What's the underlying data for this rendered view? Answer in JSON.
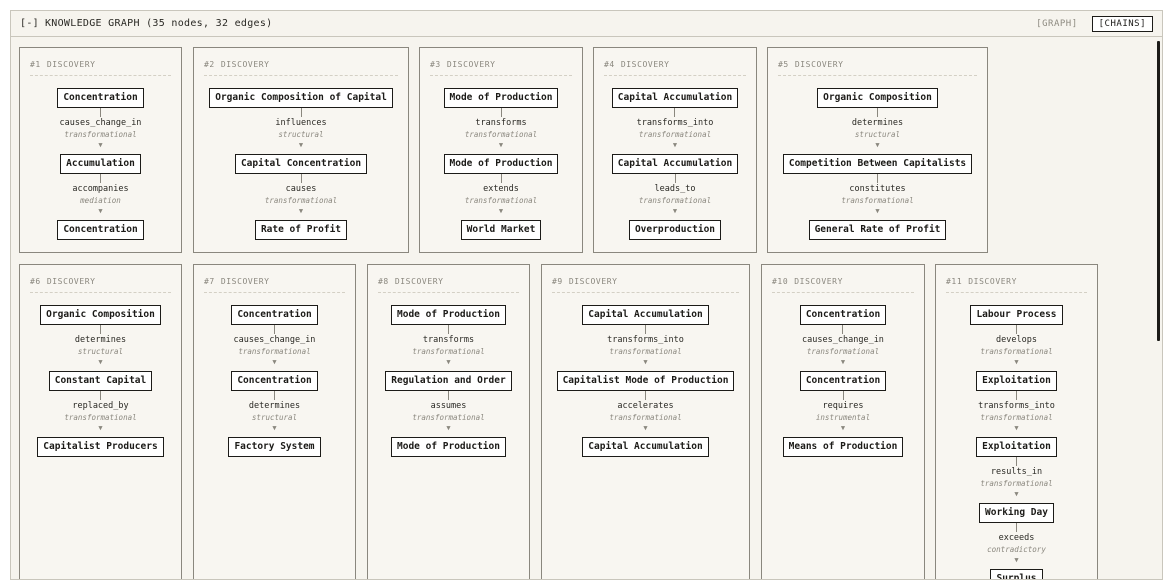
{
  "header": {
    "collapse_label": "[-]",
    "title": "KNOWLEDGE GRAPH (35 nodes, 32 edges)",
    "tabs": [
      {
        "label": "[GRAPH]",
        "active": false
      },
      {
        "label": "[CHAINS]",
        "active": true
      }
    ]
  },
  "chains": [
    {
      "num": "#1",
      "type": "DISCOVERY",
      "nodes": [
        "Concentration",
        "Accumulation",
        "Concentration"
      ],
      "edges": [
        {
          "rel": "causes_change_in",
          "kind": "transformational"
        },
        {
          "rel": "accompanies",
          "kind": "mediation"
        }
      ]
    },
    {
      "num": "#2",
      "type": "DISCOVERY",
      "nodes": [
        "Organic Composition of Capital",
        "Capital Concentration",
        "Rate of Profit"
      ],
      "edges": [
        {
          "rel": "influences",
          "kind": "structural"
        },
        {
          "rel": "causes",
          "kind": "transformational"
        }
      ]
    },
    {
      "num": "#3",
      "type": "DISCOVERY",
      "nodes": [
        "Mode of Production",
        "Mode of Production",
        "World Market"
      ],
      "edges": [
        {
          "rel": "transforms",
          "kind": "transformational"
        },
        {
          "rel": "extends",
          "kind": "transformational"
        }
      ]
    },
    {
      "num": "#4",
      "type": "DISCOVERY",
      "nodes": [
        "Capital Accumulation",
        "Capital Accumulation",
        "Overproduction"
      ],
      "edges": [
        {
          "rel": "transforms_into",
          "kind": "transformational"
        },
        {
          "rel": "leads_to",
          "kind": "transformational"
        }
      ]
    },
    {
      "num": "#5",
      "type": "DISCOVERY",
      "nodes": [
        "Organic Composition",
        "Competition Between Capitalists",
        "General Rate of Profit"
      ],
      "edges": [
        {
          "rel": "determines",
          "kind": "structural"
        },
        {
          "rel": "constitutes",
          "kind": "transformational"
        }
      ]
    },
    {
      "num": "#6",
      "type": "DISCOVERY",
      "nodes": [
        "Organic Composition",
        "Constant Capital",
        "Capitalist Producers"
      ],
      "edges": [
        {
          "rel": "determines",
          "kind": "structural"
        },
        {
          "rel": "replaced_by",
          "kind": "transformational"
        }
      ]
    },
    {
      "num": "#7",
      "type": "DISCOVERY",
      "nodes": [
        "Concentration",
        "Concentration",
        "Factory System"
      ],
      "edges": [
        {
          "rel": "causes_change_in",
          "kind": "transformational"
        },
        {
          "rel": "determines",
          "kind": "structural"
        }
      ]
    },
    {
      "num": "#8",
      "type": "DISCOVERY",
      "nodes": [
        "Mode of Production",
        "Regulation and Order",
        "Mode of Production"
      ],
      "edges": [
        {
          "rel": "transforms",
          "kind": "transformational"
        },
        {
          "rel": "assumes",
          "kind": "transformational"
        }
      ]
    },
    {
      "num": "#9",
      "type": "DISCOVERY",
      "nodes": [
        "Capital Accumulation",
        "Capitalist Mode of Production",
        "Capital Accumulation"
      ],
      "edges": [
        {
          "rel": "transforms_into",
          "kind": "transformational"
        },
        {
          "rel": "accelerates",
          "kind": "transformational"
        }
      ]
    },
    {
      "num": "#10",
      "type": "DISCOVERY",
      "nodes": [
        "Concentration",
        "Concentration",
        "Means of Production"
      ],
      "edges": [
        {
          "rel": "causes_change_in",
          "kind": "transformational"
        },
        {
          "rel": "requires",
          "kind": "instrumental"
        }
      ]
    },
    {
      "num": "#11",
      "type": "DISCOVERY",
      "nodes": [
        "Labour Process",
        "Exploitation",
        "Exploitation",
        "Working Day",
        "Surplus"
      ],
      "edges": [
        {
          "rel": "develops",
          "kind": "transformational"
        },
        {
          "rel": "transforms_into",
          "kind": "transformational"
        },
        {
          "rel": "results_in",
          "kind": "transformational"
        },
        {
          "rel": "exceeds",
          "kind": "contradictory"
        }
      ]
    }
  ]
}
